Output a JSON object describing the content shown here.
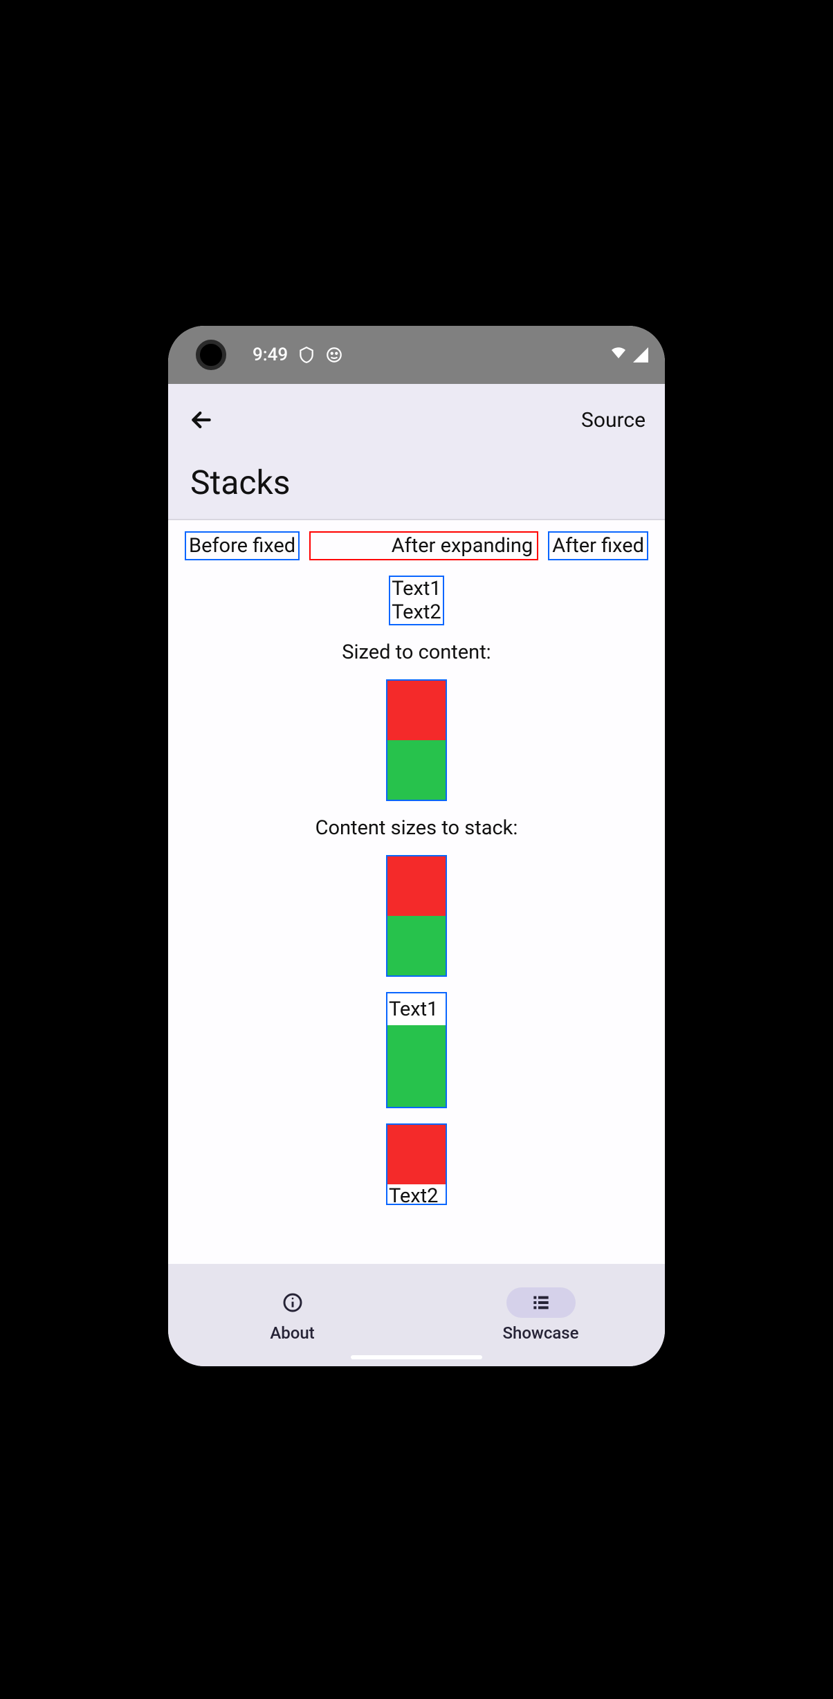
{
  "status": {
    "time": "9:49"
  },
  "appbar": {
    "source": "Source",
    "title": "Stacks"
  },
  "row": {
    "before": "Before fixed",
    "expanding": "After expanding",
    "after": "After fixed"
  },
  "textstack": {
    "t1": "Text1",
    "t2": "Text2"
  },
  "labels": {
    "sized": "Sized to content:",
    "contentSizes": "Content sizes to stack:"
  },
  "mixed1": {
    "t1": "Text1"
  },
  "mixed2": {
    "t2": "Text2"
  },
  "nav": {
    "about": "About",
    "showcase": "Showcase"
  }
}
